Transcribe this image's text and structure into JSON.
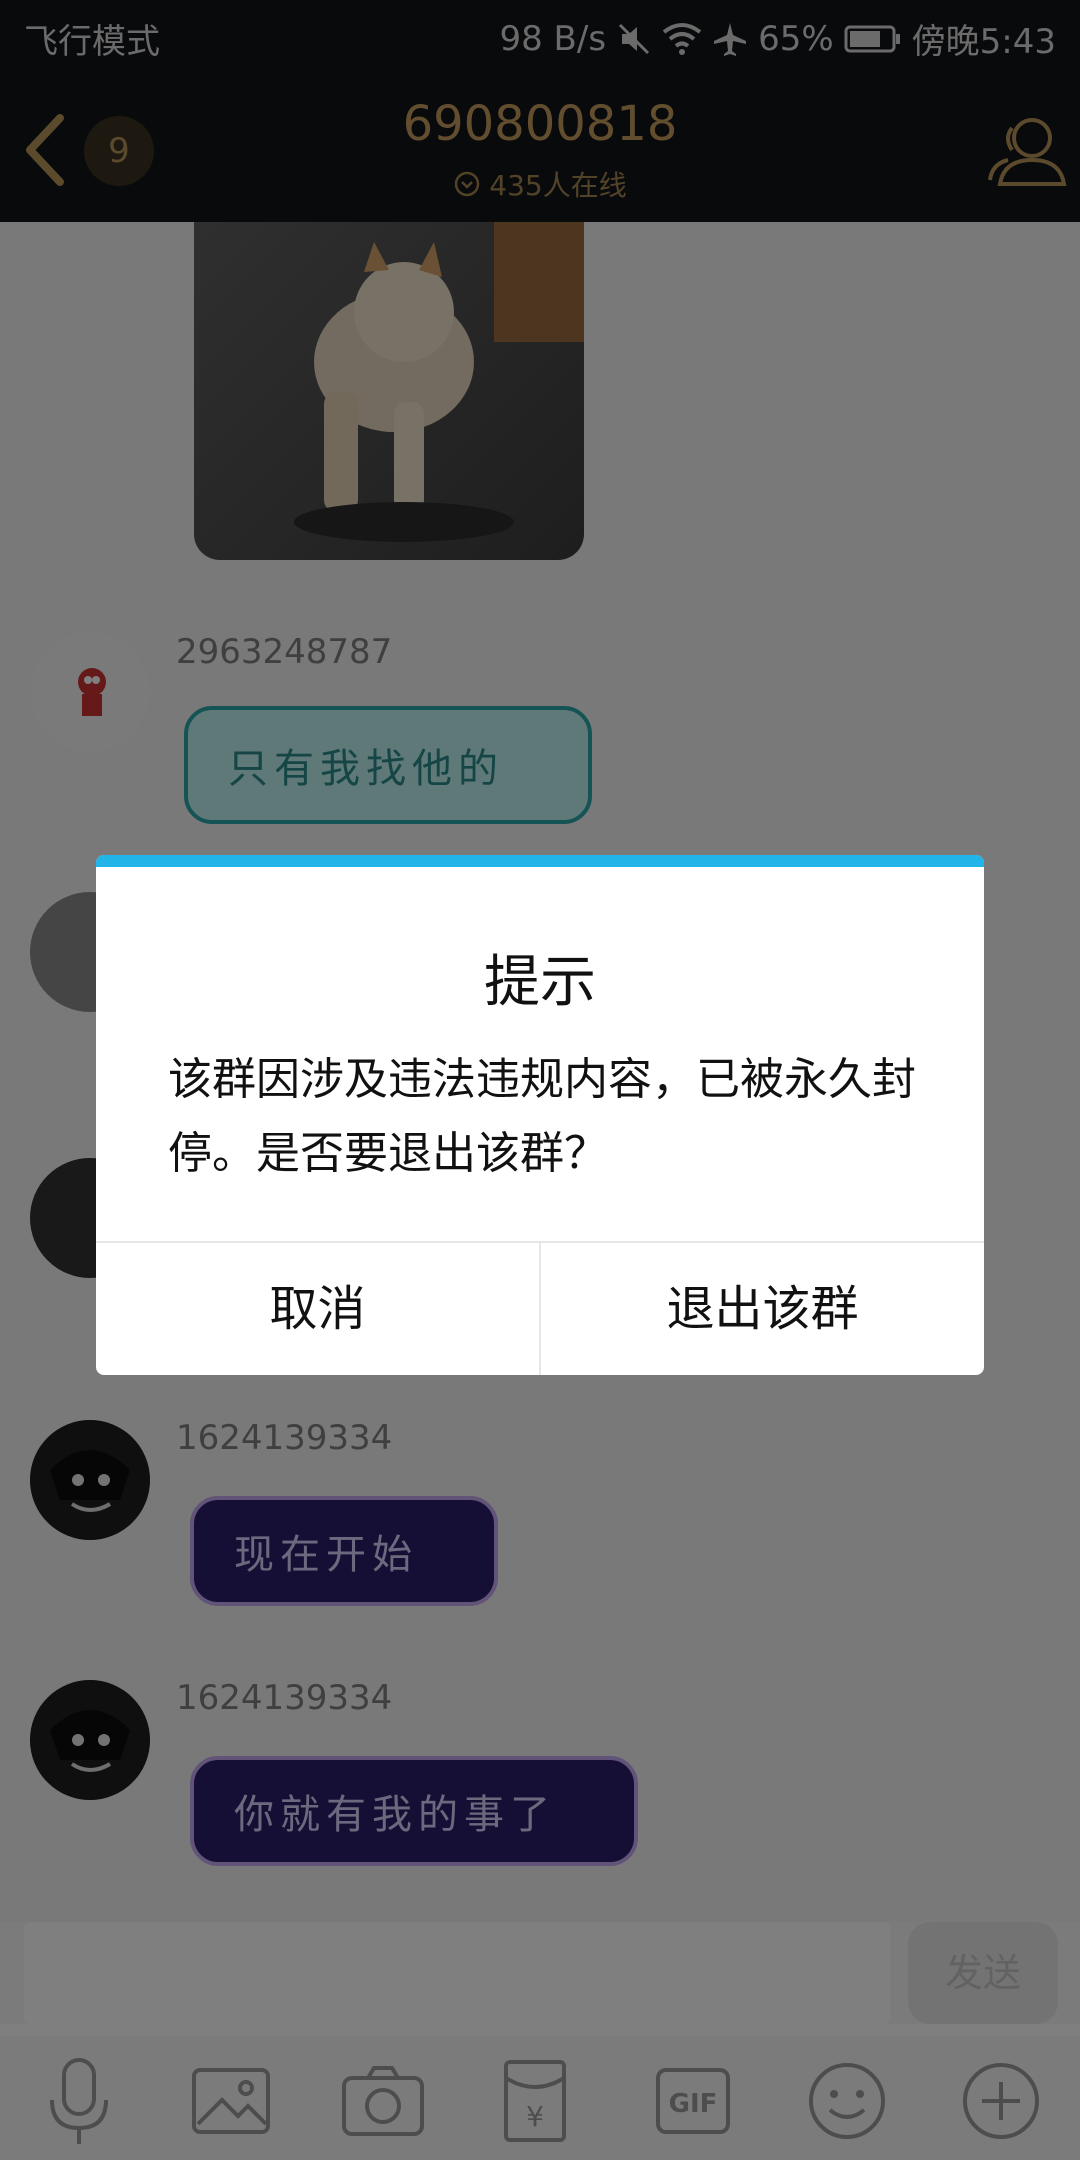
{
  "status_bar": {
    "mode": "飞行模式",
    "speed": "98 B/s",
    "battery": "65%",
    "time": "傍晚5:43",
    "icons": [
      "mute-icon",
      "wifi-icon",
      "airplane-icon",
      "battery-icon"
    ]
  },
  "header": {
    "unread_count": "9",
    "group_id": "690800818",
    "online_text": "435人在线",
    "icons": [
      "back-icon",
      "chevron-down-circle-icon",
      "members-icon"
    ]
  },
  "messages": [
    {
      "type": "image",
      "description_icon": "dog-photo"
    },
    {
      "sender": "2963248787",
      "text": "只有我找他的",
      "style": "teal"
    },
    {
      "sender": "1624139334",
      "text": "现在开始",
      "style": "purple"
    },
    {
      "sender": "1624139334",
      "text": "你就有我的事了",
      "style": "purple"
    }
  ],
  "composer": {
    "placeholder": "",
    "send_label": "发送"
  },
  "toolbar": [
    "microphone-icon",
    "image-icon",
    "camera-icon",
    "red-packet-icon",
    "gif-icon",
    "emoji-icon",
    "plus-icon"
  ],
  "dialog": {
    "title": "提示",
    "message": "该群因涉及违法违规内容，已被永久封停。是否要退出该群？",
    "cancel_label": "取消",
    "confirm_label": "退出该群",
    "accent_color": "#20b4e8"
  }
}
